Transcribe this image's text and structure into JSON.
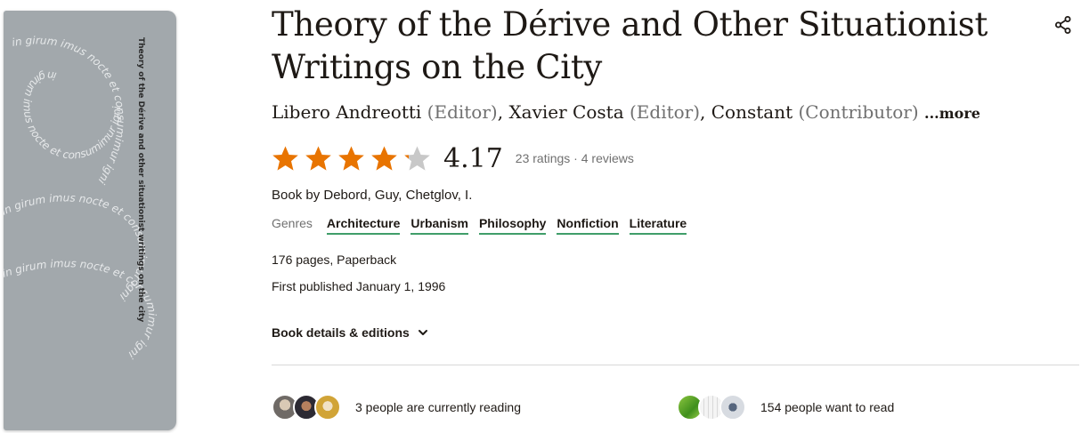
{
  "book": {
    "title": "Theory of the Dérive and Other Situationist Writings on the City",
    "cover_text": "Theory of the Dérive and other situationist writings on the city",
    "cover_spiral_text": "in girum imus nocte et consumimur igni",
    "contributors": [
      {
        "name": "Libero Andreotti",
        "role": "(Editor)",
        "sep": ", "
      },
      {
        "name": "Xavier Costa",
        "role": "(Editor)",
        "sep": ", "
      },
      {
        "name": "Constant",
        "role": "(Contributor)",
        "sep": " "
      }
    ],
    "more_label": "...more"
  },
  "rating": {
    "average": "4.17",
    "stars_filled": 4.17,
    "ratings_count": "23 ratings",
    "separator": " · ",
    "reviews_count": "4 reviews",
    "star_color": "#e87400",
    "star_empty_color": "#c8c8c8"
  },
  "description": "Book by Debord, Guy, Chetglov, I.",
  "genres": {
    "label": "Genres",
    "items": [
      "Architecture",
      "Urbanism",
      "Philosophy",
      "Nonfiction",
      "Literature"
    ],
    "underline_color": "#409d69"
  },
  "format": "176 pages, Paperback",
  "published": "First published January 1, 1996",
  "details_link": "Book details & editions",
  "social": {
    "currently_reading": "3 people are currently reading",
    "want_to_read": "154 people want to read"
  },
  "icons": {
    "share": "share-icon",
    "chevron": "chevron-down-icon",
    "star": "star-icon"
  }
}
